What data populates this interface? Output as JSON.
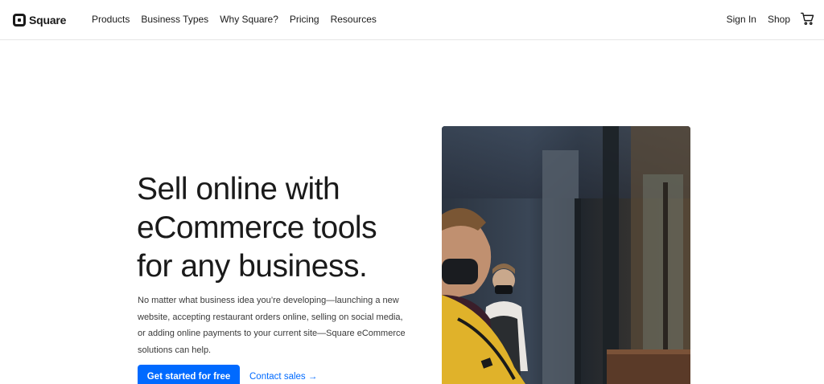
{
  "nav": {
    "logo_text": "Square",
    "links": [
      "Products",
      "Business Types",
      "Why Square?",
      "Pricing",
      "Resources"
    ],
    "sign_in": "Sign In",
    "shop": "Shop",
    "cart_icon": "cart-icon"
  },
  "hero": {
    "title_lines": [
      "Sell online with",
      "eCommerce tools",
      "for any business."
    ],
    "body": "No matter what business idea you’re developing—launching a new website, accepting restaurant orders online, selling on social media, or adding online payments to your current site—Square eCommerce solutions can help.",
    "cta_label": "Get started for free",
    "contact_label": "Contact sales",
    "contact_arrow": "→"
  },
  "colors": {
    "accent": "#006aff",
    "text": "#1a1a1a"
  }
}
